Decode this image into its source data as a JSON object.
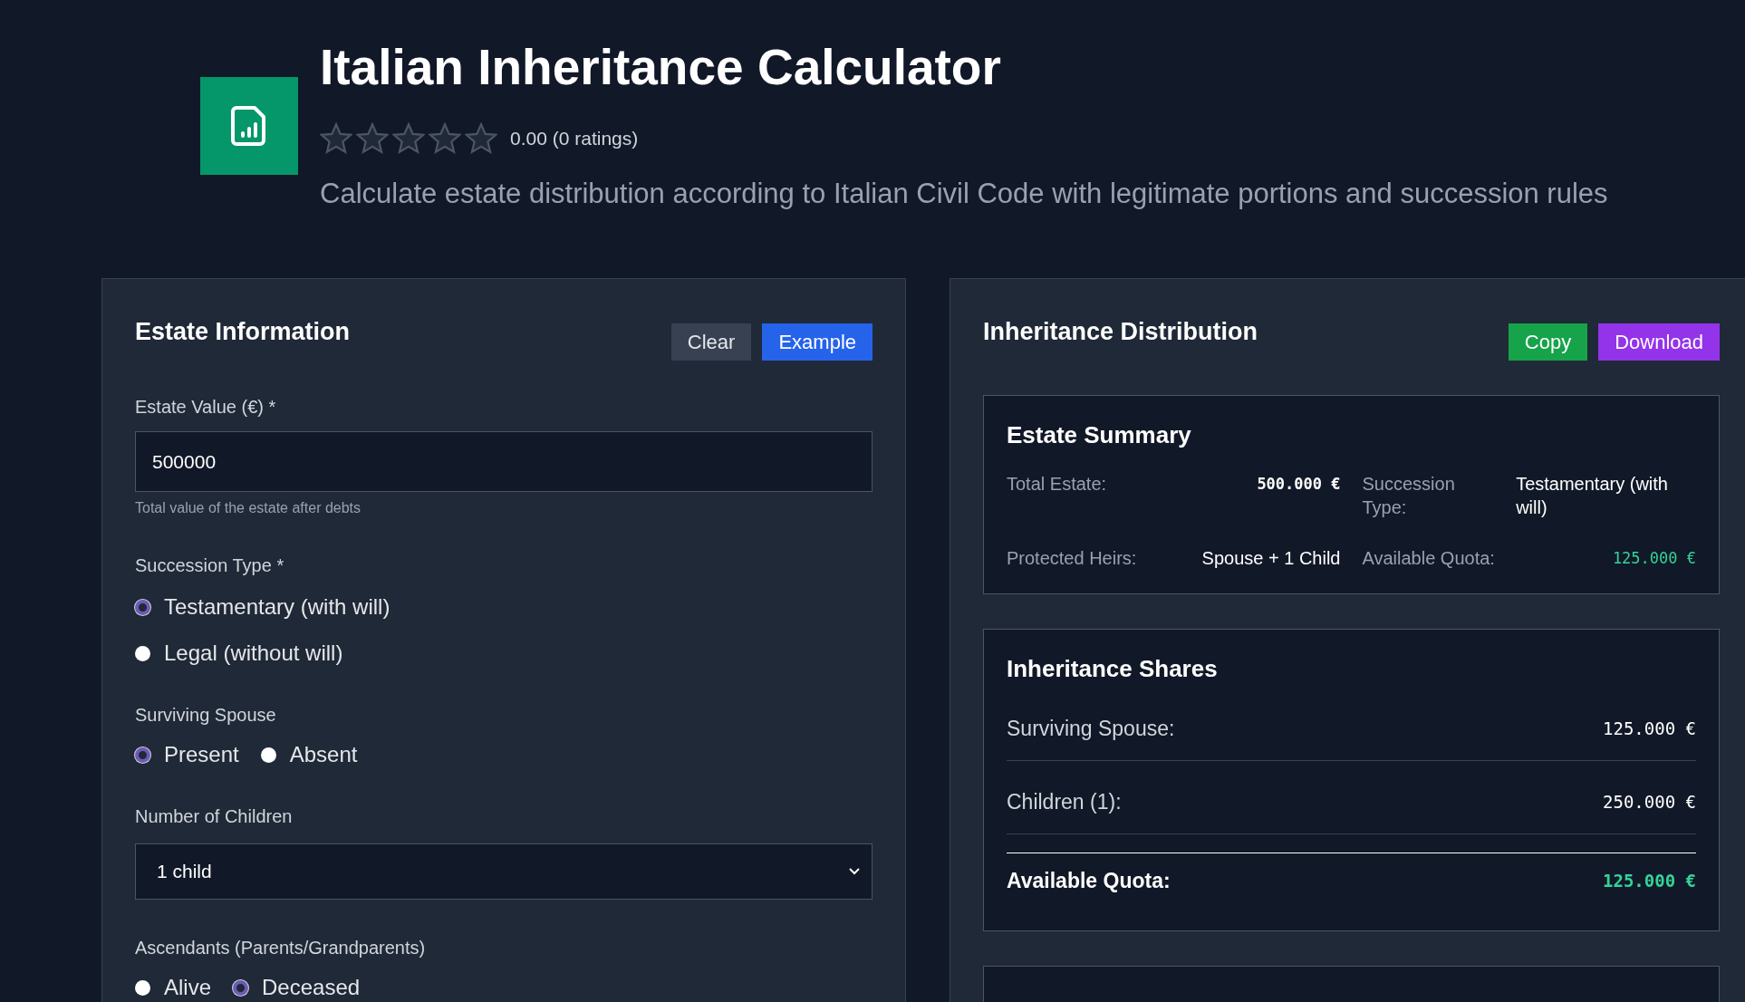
{
  "header": {
    "title": "Italian Inheritance Calculator",
    "rating": {
      "stars": 0,
      "text": "0.00 (0 ratings)"
    },
    "description": "Calculate estate distribution according to Italian Civil Code with legitimate portions and succession rules"
  },
  "estate_form": {
    "title": "Estate Information",
    "buttons": [
      {
        "label": "Clear",
        "kind": "secondary"
      },
      {
        "label": "Example",
        "kind": "primary"
      }
    ],
    "fields": [
      {
        "kind": "input",
        "label": "Estate Value (€) *",
        "value": "500000",
        "hint": "Total value of the estate after debts"
      },
      {
        "kind": "radio_list",
        "label": "Succession Type *",
        "options": [
          {
            "label": "Testamentary (with will)",
            "selected": true
          },
          {
            "label": "Legal (without will)",
            "selected": false
          }
        ]
      },
      {
        "kind": "radio_row",
        "label": "Surviving Spouse",
        "options": [
          {
            "label": "Present",
            "selected": true
          },
          {
            "label": "Absent",
            "selected": false
          }
        ]
      },
      {
        "kind": "select",
        "label": "Number of Children",
        "value": "1 child"
      },
      {
        "kind": "radio_row",
        "label": "Ascendants (Parents/Grandparents)",
        "options": [
          {
            "label": "Alive",
            "selected": false
          },
          {
            "label": "Deceased",
            "selected": true
          }
        ]
      }
    ]
  },
  "distribution": {
    "title": "Inheritance Distribution",
    "buttons": [
      {
        "label": "Copy",
        "kind": "success"
      },
      {
        "label": "Download",
        "kind": "accent"
      }
    ],
    "estate_summary": {
      "title": "Estate Summary",
      "items": [
        {
          "label": "Total Estate:",
          "value": "500.000 €",
          "kind": "amount"
        },
        {
          "label": "Succession Type:",
          "value": "Testamentary (with will)",
          "kind": "text"
        },
        {
          "label": "Protected Heirs:",
          "value": "Spouse + 1 Child",
          "kind": "text"
        },
        {
          "label": "Available Quota:",
          "value": "125.000 €",
          "kind": "highlight"
        }
      ]
    },
    "inheritance_shares": {
      "title": "Inheritance Shares",
      "rows": [
        {
          "label": "Surviving Spouse:",
          "value": "125.000 €",
          "kind": "share"
        },
        {
          "label": "Children (1):",
          "value": "250.000 €",
          "kind": "share"
        },
        {
          "label": "Available Quota:",
          "value": "125.000 €",
          "kind": "total"
        }
      ]
    }
  }
}
